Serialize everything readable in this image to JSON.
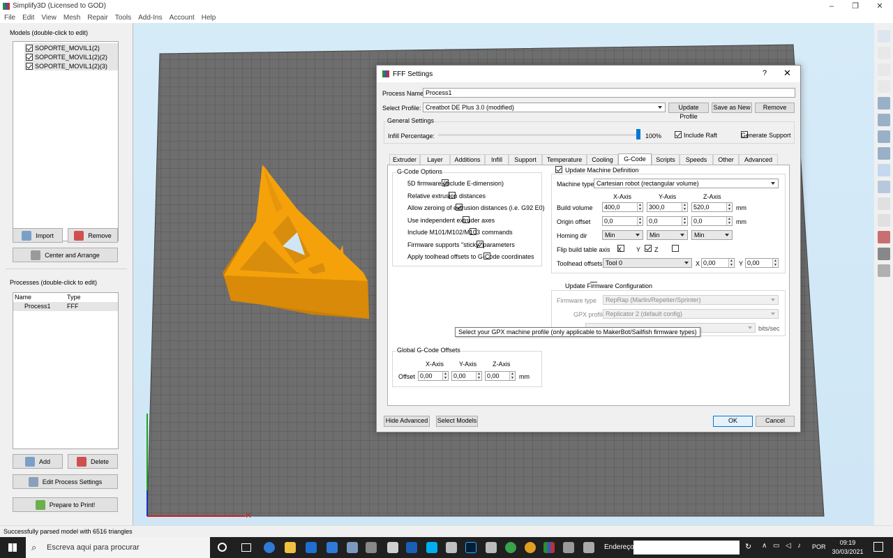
{
  "window": {
    "title": "Simplify3D (Licensed to GOD)"
  },
  "menu": [
    "File",
    "Edit",
    "View",
    "Mesh",
    "Repair",
    "Tools",
    "Add-Ins",
    "Account",
    "Help"
  ],
  "models": {
    "title": "Models (double-click to edit)",
    "items": [
      "SOPORTE_MOVIL1(2)",
      "SOPORTE_MOVIL1(2)(2)",
      "SOPORTE_MOVIL1(2)(3)"
    ],
    "import_label": "Import",
    "remove_label": "Remove",
    "center_label": "Center and Arrange"
  },
  "processes": {
    "title": "Processes (double-click to edit)",
    "col_name": "Name",
    "col_type": "Type",
    "rows": [
      {
        "name": "Process1",
        "type": "FFF"
      }
    ],
    "add_label": "Add",
    "delete_label": "Delete",
    "edit_label": "Edit Process Settings",
    "print_label": "Prepare to Print!"
  },
  "status": "Successfully parsed model with 6516 triangles",
  "dialog": {
    "title": "FFF Settings",
    "help": "?",
    "process_name_label": "Process Name:",
    "process_name": "Process1",
    "profile_label": "Select Profile:",
    "profile": "Creatbot DE Plus 3.0 (modified)",
    "update_profile": "Update Profile",
    "save_as_new": "Save as New",
    "remove": "Remove",
    "general_settings": "General Settings",
    "infill_label": "Infill Percentage:",
    "infill_value": "100%",
    "infill_fraction": 1.0,
    "include_raft": "Include Raft",
    "generate_support": "Generate Support",
    "tabs": [
      "Extruder",
      "Layer",
      "Additions",
      "Infill",
      "Support",
      "Temperature",
      "Cooling",
      "G-Code",
      "Scripts",
      "Speeds",
      "Other",
      "Advanced"
    ],
    "active_tab": "G-Code",
    "gcode_options": {
      "title": "G-Code Options",
      "items": [
        {
          "label": "5D firmware (include E-dimension)",
          "checked": true
        },
        {
          "label": "Relative extrusion distances",
          "checked": false
        },
        {
          "label": "Allow zeroing of extrusion distances (i.e. G92 E0)",
          "checked": true
        },
        {
          "label": "Use independent extruder axes",
          "checked": false
        },
        {
          "label": "Include M101/M102/M103 commands",
          "checked": false
        },
        {
          "label": "Firmware supports \"sticky\" parameters",
          "checked": true
        },
        {
          "label": "Apply toolhead offsets to G-Code coordinates",
          "checked": false
        }
      ]
    },
    "global_offsets": {
      "title": "Global G-Code Offsets",
      "x_axis": "X-Axis",
      "y_axis": "Y-Axis",
      "z_axis": "Z-Axis",
      "offset_label": "Offset",
      "x": "0,00",
      "y": "0,00",
      "z": "0,00",
      "unit": "mm"
    },
    "machine": {
      "update_label": "Update Machine Definition",
      "type_label": "Machine type",
      "type": "Cartesian robot (rectangular volume)",
      "x_axis": "X-Axis",
      "y_axis": "Y-Axis",
      "z_axis": "Z-Axis",
      "build_label": "Build volume",
      "build": [
        "400,0",
        "300,0",
        "520,0"
      ],
      "origin_label": "Origin offset",
      "origin": [
        "0,0",
        "0,0",
        "0,0"
      ],
      "homing_label": "Homing dir",
      "homing": [
        "Min",
        "Min",
        "Min"
      ],
      "unit": "mm",
      "flip_label": "Flip build table axis",
      "flip_x": "X",
      "flip_y": "Y",
      "flip_z": "Z",
      "toolhead_label": "Toolhead offsets",
      "toolhead": "Tool 0",
      "th_x_label": "X",
      "th_x": "0,00",
      "th_y_label": "Y",
      "th_y": "0,00"
    },
    "firmware": {
      "update_label": "Update Firmware Configuration",
      "type_label": "Firmware type",
      "type": "RepRap (Marlin/Repetier/Sprinter)",
      "gpx_label": "GPX profile",
      "gpx": "Replicator 2 (default config)",
      "baud_unit": "bits/sec"
    },
    "tooltip": "Select your GPX machine profile (only applicable to MakerBot/Sailfish firmware types)",
    "hide_advanced": "Hide Advanced",
    "select_models": "Select Models",
    "ok": "OK",
    "cancel": "Cancel"
  },
  "taskbar": {
    "search": "Escreva aqui para procurar",
    "address_label": "Endereço",
    "lang": "POR",
    "time": "09:19",
    "date": "30/03/2021"
  },
  "colors": {
    "model": "#f5a20a",
    "bed": "#6e6e6e",
    "accent": "#0078d7"
  }
}
